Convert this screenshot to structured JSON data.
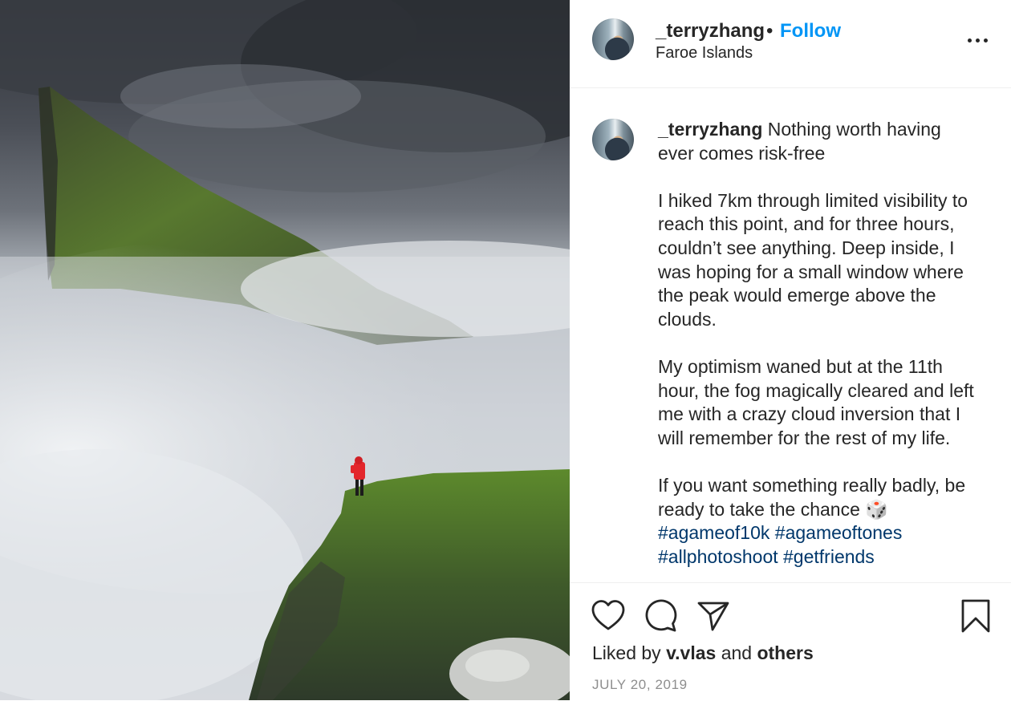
{
  "post": {
    "username": "_terryzhang",
    "separator": "•",
    "follow_label": "Follow",
    "location": "Faroe Islands",
    "more_icon": "more-horizontal-icon"
  },
  "caption": {
    "username": "_terryzhang",
    "paragraphs": [
      "Nothing worth having ever comes risk-free",
      "I hiked 7km through limited visibility to reach this point, and for three hours, couldn’t see anything. Deep inside, I was hoping for a small window where the peak would emerge above the clouds.",
      "My optimism waned but at the 11th hour, the fog magically cleared and left me with a crazy cloud inversion that I will remember for the rest of my life.",
      "If you want something really badly, be ready to take the chance 🎲"
    ],
    "hashtags": "#agameof10k #agameoftones",
    "hashtags_more": "#allphotoshoot #getfriends"
  },
  "actions": {
    "like_icon": "heart-icon",
    "comment_icon": "comment-icon",
    "share_icon": "share-icon",
    "save_icon": "bookmark-icon"
  },
  "likes": {
    "prefix": "Liked by",
    "user": "v.vlas",
    "joiner": "and",
    "others": "others"
  },
  "date": "JULY 20, 2019",
  "colors": {
    "link_blue": "#0095f6",
    "hashtag": "#00376b",
    "text": "#262626",
    "muted": "#8e8e8e",
    "border": "#efefef"
  }
}
